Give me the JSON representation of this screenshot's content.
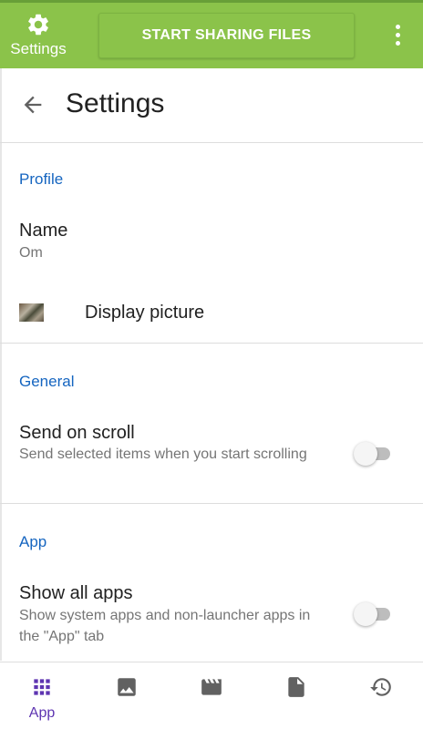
{
  "topbar": {
    "settings_label": "Settings",
    "share_button": "START SHARING FILES",
    "overflow_icon": "more-vertical-icon",
    "color": "#8bc34a"
  },
  "header": {
    "title": "Settings",
    "back_icon": "arrow-back-icon"
  },
  "sections": {
    "profile": {
      "title": "Profile",
      "name_label": "Name",
      "name_value": "Om",
      "display_picture_label": "Display picture"
    },
    "general": {
      "title": "General",
      "send_on_scroll_title": "Send on scroll",
      "send_on_scroll_sub": "Send selected items when you start scrolling",
      "send_on_scroll_enabled": false
    },
    "app": {
      "title": "App",
      "show_all_apps_title": "Show all apps",
      "show_all_apps_sub": "Show system apps and non-launcher apps in the \"App\" tab",
      "show_all_apps_enabled": false
    }
  },
  "bottom_nav": {
    "items": [
      {
        "label": "App",
        "icon": "apps-grid-icon",
        "active": true
      },
      {
        "label": "",
        "icon": "image-icon",
        "active": false
      },
      {
        "label": "",
        "icon": "video-icon",
        "active": false
      },
      {
        "label": "",
        "icon": "file-icon",
        "active": false
      },
      {
        "label": "",
        "icon": "history-icon",
        "active": false
      }
    ],
    "active_color": "#5e35b1",
    "icon_color": "#616161"
  },
  "colors": {
    "accent_text": "#1565c0"
  }
}
